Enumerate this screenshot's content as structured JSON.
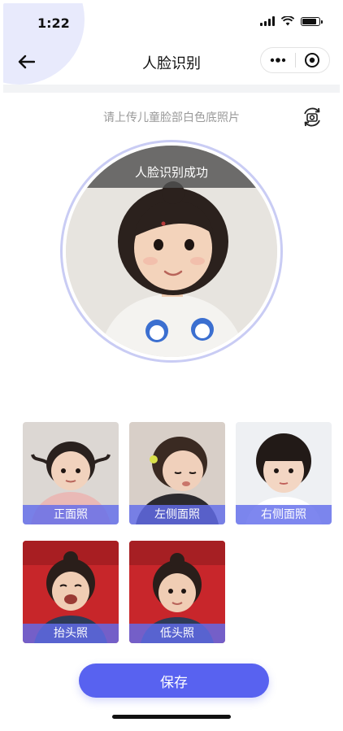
{
  "status_bar": {
    "time": "1:22",
    "battery_level_percent": 85
  },
  "nav": {
    "title": "人脸识别",
    "back_icon": "arrow-left-icon",
    "more_icon": "more-dots-icon",
    "close_icon": "target-close-icon"
  },
  "upload": {
    "hint": "请上传儿童脸部白色底照片",
    "switch_icon": "camera-switch-icon"
  },
  "recognition": {
    "status": "人脸识别成功",
    "photo": "child-portrait"
  },
  "thumbnails": [
    {
      "label": "正面照",
      "photo": "child-front"
    },
    {
      "label": "左侧面照",
      "photo": "child-left"
    },
    {
      "label": "右侧面照",
      "photo": "child-right"
    },
    {
      "label": "抬头照",
      "photo": "child-head-up"
    },
    {
      "label": "低头照",
      "photo": "child-head-down"
    }
  ],
  "actions": {
    "save_label": "保存"
  },
  "colors": {
    "accent": "#5862f0",
    "thumb_label_bg": "#626cec",
    "ring": "#c9ccf4"
  }
}
